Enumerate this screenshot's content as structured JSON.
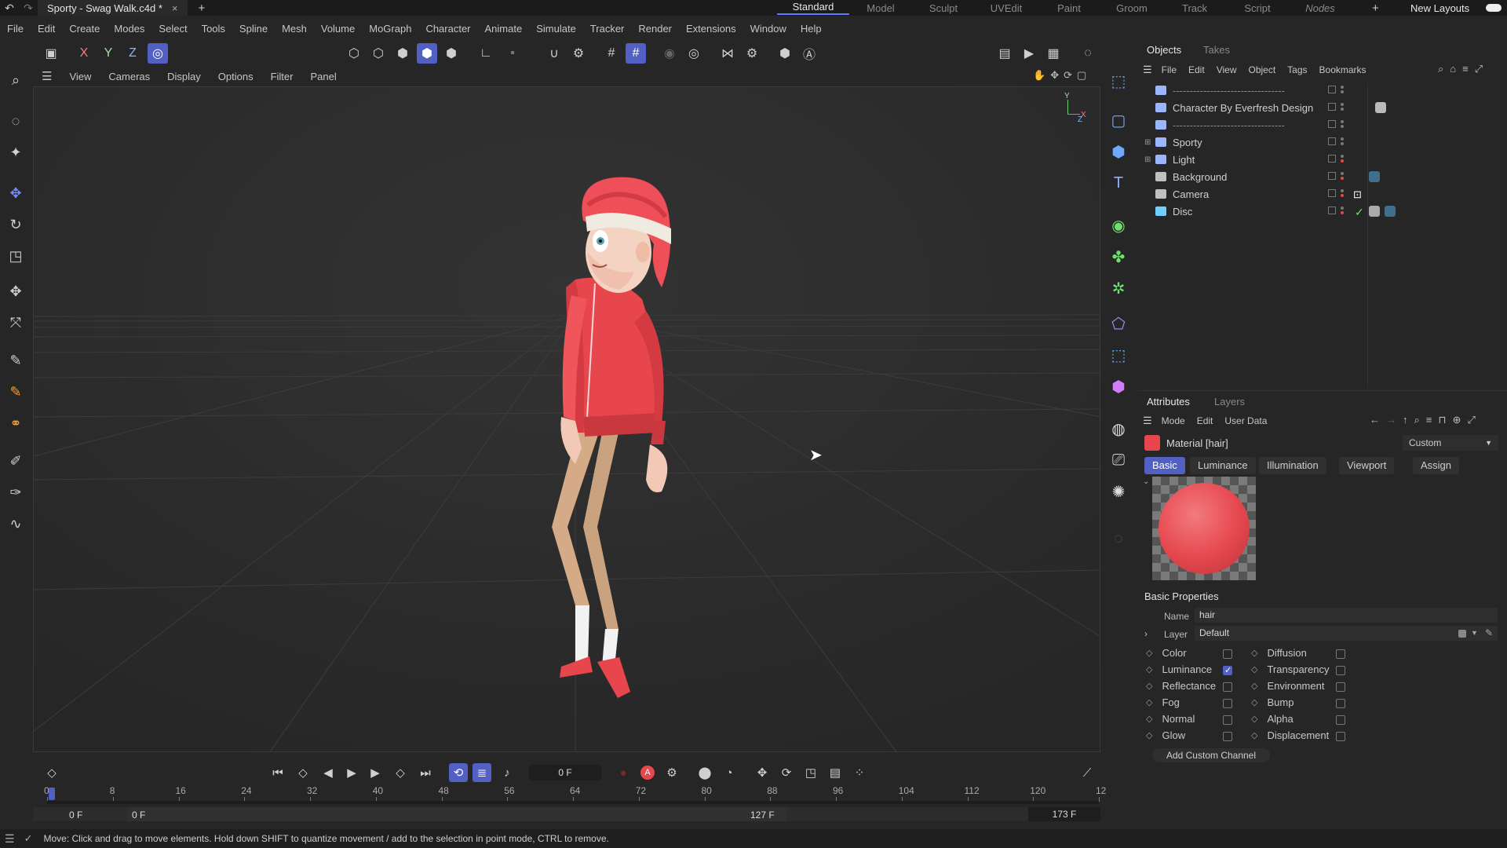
{
  "titlebar": {
    "doc_tab": "Sporty - Swag Walk.c4d *",
    "layouts": [
      "Standard",
      "Model",
      "Sculpt",
      "UVEdit",
      "Paint",
      "Groom",
      "Track",
      "Script",
      "Nodes"
    ],
    "active_layout": "Standard",
    "new_layouts": "New Layouts"
  },
  "menu": [
    "File",
    "Edit",
    "Create",
    "Modes",
    "Select",
    "Tools",
    "Spline",
    "Mesh",
    "Volume",
    "MoGraph",
    "Character",
    "Animate",
    "Simulate",
    "Tracker",
    "Render",
    "Extensions",
    "Window",
    "Help"
  ],
  "toolbar": {
    "axis_x": "X",
    "axis_y": "Y",
    "axis_z": "Z"
  },
  "viewport_menu": [
    "View",
    "Cameras",
    "Display",
    "Options",
    "Filter",
    "Panel"
  ],
  "objects_panel": {
    "tabs": [
      "Objects",
      "Takes"
    ],
    "menu": [
      "File",
      "Edit",
      "View",
      "Object",
      "Tags",
      "Bookmarks"
    ],
    "rows": [
      {
        "name": "---------------------------------"
      },
      {
        "name": "Character By Everfresh Design"
      },
      {
        "name": "---------------------------------"
      },
      {
        "name": "Sporty"
      },
      {
        "name": "Light"
      },
      {
        "name": "Background"
      },
      {
        "name": "Camera"
      },
      {
        "name": "Disc"
      }
    ]
  },
  "attributes": {
    "tabs": [
      "Attributes",
      "Layers"
    ],
    "menu": [
      "Mode",
      "Edit",
      "User Data"
    ],
    "material_title": "Material [hair]",
    "preset": "Custom",
    "subtabs": [
      "Basic",
      "Luminance",
      "Illumination",
      "Viewport",
      "Assign"
    ],
    "section_title": "Basic Properties",
    "name_label": "Name",
    "name_value": "hair",
    "layer_label": "Layer",
    "layer_value": "Default",
    "channels_left": [
      {
        "label": "Color",
        "checked": false
      },
      {
        "label": "Luminance",
        "checked": true
      },
      {
        "label": "Reflectance",
        "checked": false
      },
      {
        "label": "Fog",
        "checked": false
      },
      {
        "label": "Normal",
        "checked": false
      },
      {
        "label": "Glow",
        "checked": false
      }
    ],
    "channels_right": [
      {
        "label": "Diffusion",
        "checked": false
      },
      {
        "label": "Transparency",
        "checked": false
      },
      {
        "label": "Environment",
        "checked": false
      },
      {
        "label": "Bump",
        "checked": false
      },
      {
        "label": "Alpha",
        "checked": false
      },
      {
        "label": "Displacement",
        "checked": false
      }
    ],
    "add_channel": "Add Custom Channel"
  },
  "timeline": {
    "current_frame": "0 F",
    "ruler": [
      "0",
      "8",
      "16",
      "24",
      "32",
      "40",
      "48",
      "56",
      "64",
      "72",
      "80",
      "88",
      "96",
      "104",
      "112",
      "120",
      "12"
    ],
    "start": "0 F",
    "range_start": "0 F",
    "range_end": "127 F",
    "end": "173 F"
  },
  "status": "Move: Click and drag to move elements. Hold down SHIFT to quantize movement / add to the selection in point mode, CTRL to remove.",
  "colors": {
    "accent": "#5260c4",
    "character_red": "#e8464d"
  }
}
